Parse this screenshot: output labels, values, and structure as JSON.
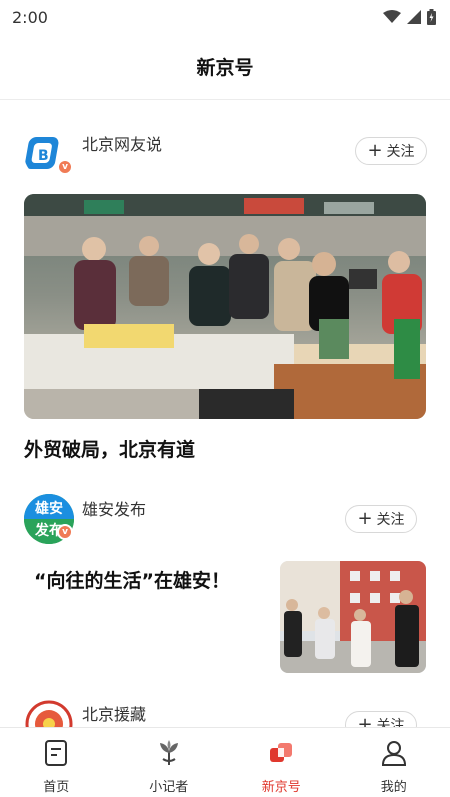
{
  "status_bar": {
    "time": "2:00"
  },
  "header": {
    "title": "新京号"
  },
  "feed": {
    "items": [
      {
        "account": "北京网友说",
        "follow_label": "关注",
        "avatar_text": "",
        "headline": "外贸破局，北京有道"
      },
      {
        "account": "雄安发布",
        "follow_label": "关注",
        "avatar_text_1": "雄安",
        "avatar_text_2": "发布",
        "headline": "“向往的生活”在雄安！"
      },
      {
        "account": "北京援藏",
        "follow_label": "关注"
      }
    ]
  },
  "tabbar": {
    "tabs": [
      {
        "label": "首页",
        "icon": "home-doc-icon"
      },
      {
        "label": "小记者",
        "icon": "plant-icon"
      },
      {
        "label": "新京号",
        "icon": "xinjinghao-icon",
        "active": true
      },
      {
        "label": "我的",
        "icon": "person-icon"
      }
    ]
  },
  "colors": {
    "accent": "#e0382e",
    "badge": "#f07b55"
  }
}
